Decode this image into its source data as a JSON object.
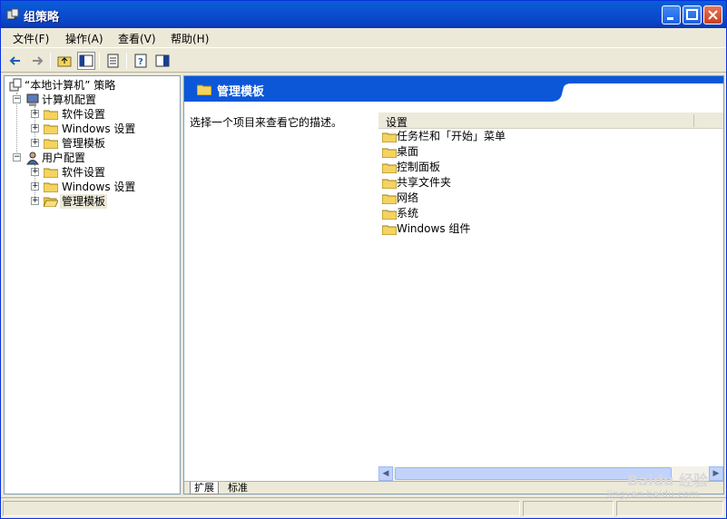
{
  "window": {
    "title": "组策略"
  },
  "menu": {
    "file": "文件(F)",
    "action": "操作(A)",
    "view": "查看(V)",
    "help": "帮助(H)"
  },
  "tree": {
    "root": "“本地计算机” 策略",
    "computer_config": "计算机配置",
    "computer_children": [
      "软件设置",
      "Windows 设置",
      "管理模板"
    ],
    "user_config": "用户配置",
    "user_children": [
      "软件设置",
      "Windows 设置",
      "管理模板"
    ]
  },
  "right": {
    "header_title": "管理模板",
    "description": "选择一个项目来查看它的描述。",
    "column_header": "设置",
    "items": [
      "任务栏和「开始」菜单",
      "桌面",
      "控制面板",
      "共享文件夹",
      "网络",
      "系统",
      "Windows 组件"
    ]
  },
  "tabs": {
    "extended": "扩展",
    "standard": "标准"
  },
  "watermark": {
    "brand": "Baidu 经验",
    "url": "jingyan.baidu.com"
  },
  "colors": {
    "title_bar": "#0a5fd6",
    "header_blue": "#0b57d8",
    "folder_yellow": "#f4d35e"
  }
}
